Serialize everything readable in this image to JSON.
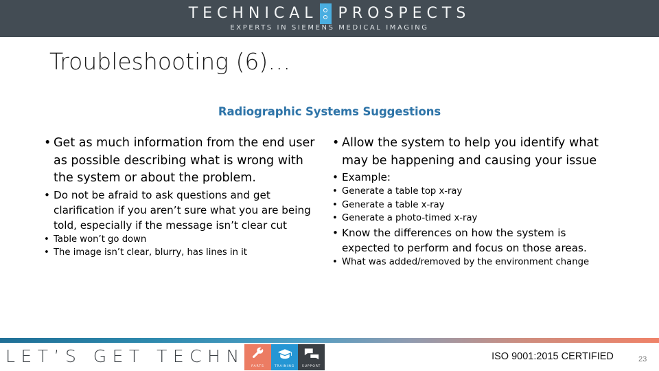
{
  "header": {
    "brand_word1": "TECHNICAL",
    "brand_word2": "PROSPECTS",
    "tagline": "EXPERTS IN SIEMENS MEDICAL IMAGING",
    "background_color": "#434c54",
    "accent_color": "#4aaee0"
  },
  "slide": {
    "title": "Troubleshooting (6)…",
    "subtitle": "Radiographic Systems Suggestions",
    "subtitle_color": "#2e74a8"
  },
  "content": {
    "left_column": {
      "level1": "Get as much information from the end user as possible describing what is wrong with the system or about the problem.",
      "level2": "Do not be afraid to ask questions and get clarification if you aren’t sure what you are being told, especially if the message isn’t clear cut",
      "level3": [
        "Table won’t go down",
        "The image isn’t clear, blurry, has lines in it"
      ]
    },
    "right_column": {
      "level1": "Allow the system to help you identify what may be happening and causing your issue",
      "level2_example": "Example:",
      "level3_examples": [
        "Generate a table top x-ray",
        "Generate a table x-ray",
        "Generate a photo-timed x-ray"
      ],
      "level2_know": "Know the differences on how the system is expected to perform and focus on those areas.",
      "level3_environment": "What was added/removed by the environment change"
    }
  },
  "footer": {
    "slogan": "LET’S GET TECHNICAL",
    "iso_text": "ISO 9001:2015 CERTIFIED",
    "page_number": "23",
    "tiles": [
      {
        "label": "PARTS",
        "icon": "wrench-icon",
        "color": "#ec7c63"
      },
      {
        "label": "TRAINING",
        "icon": "graduation-cap-icon",
        "color": "#2596d4"
      },
      {
        "label": "SUPPORT",
        "icon": "speech-bubbles-icon",
        "color": "#3a3f44"
      }
    ],
    "gradient_start": "#1f6f96",
    "gradient_end": "#ef8268"
  },
  "bullet_glyph": "•"
}
